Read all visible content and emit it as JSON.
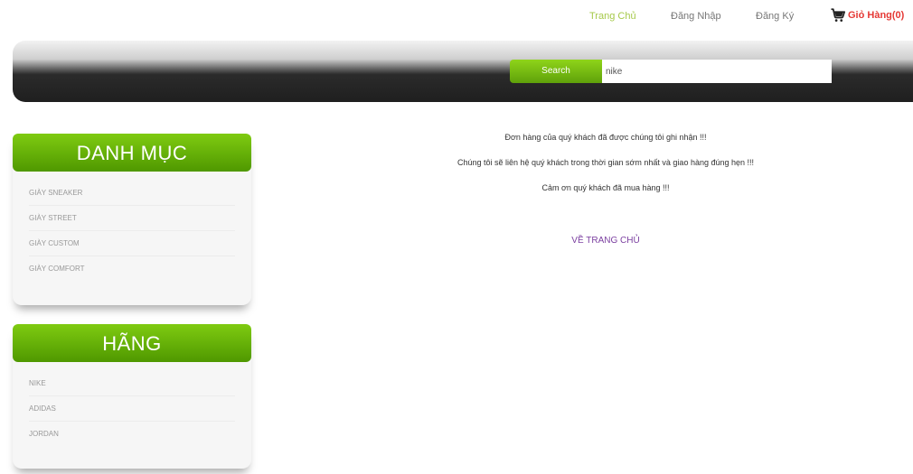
{
  "topnav": {
    "home": "Trang Chủ",
    "login": "Đăng Nhập",
    "register": "Đăng Ký",
    "cart": "Giỏ Hàng(0)"
  },
  "search": {
    "button": "Search",
    "value": "nike"
  },
  "sidebar": {
    "categories": {
      "title": "DANH MỤC",
      "items": [
        "GIÀY SNEAKER",
        "GIÀY STREET",
        "GIÀY CUSTOM",
        "GIÀY COMFORT"
      ]
    },
    "brands": {
      "title": "HÃNG",
      "items": [
        "NIKE",
        "ADIDAS",
        "JORDAN"
      ]
    }
  },
  "main": {
    "line1": "Đơn hàng của quý khách đã được chúng tôi ghi nhận !!!",
    "line2": "Chúng tôi sẽ liên hệ quý khách trong thời gian sớm nhất và giao hàng đúng hẹn !!!",
    "line3": "Cảm ơn quý khách đã mua hàng !!!",
    "back_link": "VỀ TRANG CHỦ"
  },
  "colors": {
    "accent_green": "#6bb80c",
    "link_purple": "#7b3fa0",
    "cart_red": "#e53935"
  }
}
